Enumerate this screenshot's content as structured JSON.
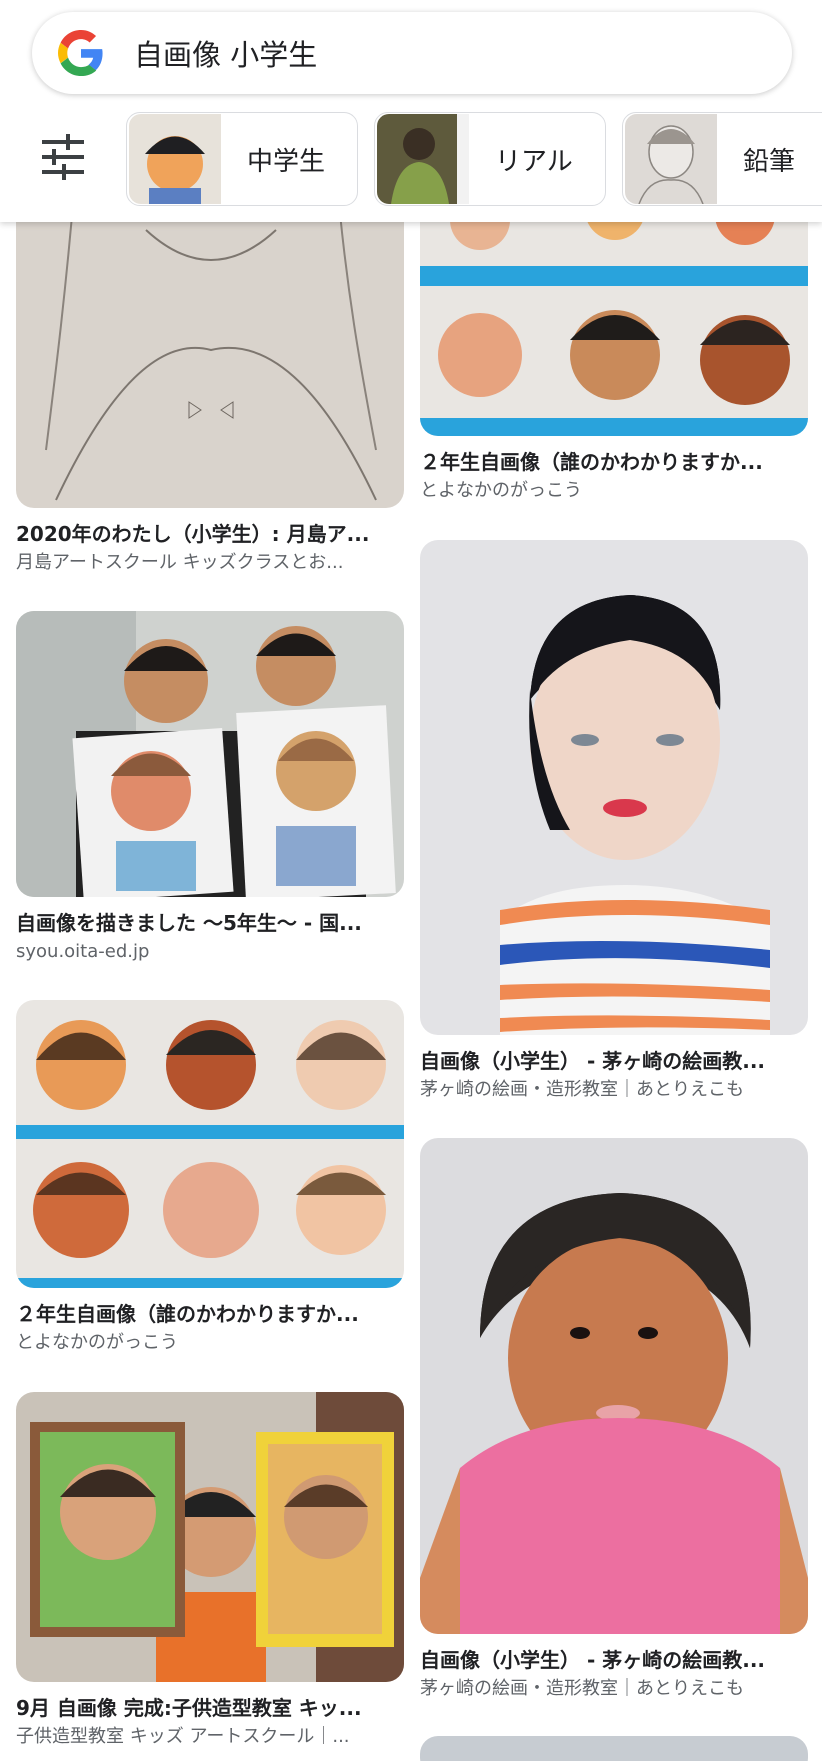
{
  "search": {
    "query": "自画像 小学生"
  },
  "chips": [
    {
      "label": "中学生"
    },
    {
      "label": "リアル"
    },
    {
      "label": "鉛筆"
    }
  ],
  "results": {
    "left": [
      {
        "title": "2020年のわたし（小学生）: 月島ア...",
        "source": "月島アートスクール キッズクラスとお..."
      },
      {
        "title": "自画像を描きました ～5年生～ - 国...",
        "source": "syou.oita-ed.jp"
      },
      {
        "title": "２年生自画像（誰のかわかりますか...",
        "source": "とよなかのがっこう"
      },
      {
        "title": "9月 自画像 完成:子供造型教室 キッ...",
        "source": "子供造型教室 キッズ アートスクール｜..."
      }
    ],
    "right": [
      {
        "title": "２年生自画像（誰のかわかりますか...",
        "source": "とよなかのがっこう"
      },
      {
        "title": "自画像（小学生） - 茅ヶ崎の絵画教...",
        "source": "茅ヶ崎の絵画・造形教室｜あとりえこも"
      },
      {
        "title": "自画像（小学生） - 茅ヶ崎の絵画教...",
        "source": "茅ヶ崎の絵画・造形教室｜あとりえこも"
      }
    ]
  },
  "icons": {
    "logo": "google-g-icon",
    "filter": "tune-sliders-icon"
  },
  "colors": {
    "google_blue": "#4285F4",
    "google_red": "#EA4335",
    "google_yellow": "#FBBC05",
    "google_green": "#34A853",
    "title_text": "#202124",
    "source_text": "#5f6368"
  }
}
